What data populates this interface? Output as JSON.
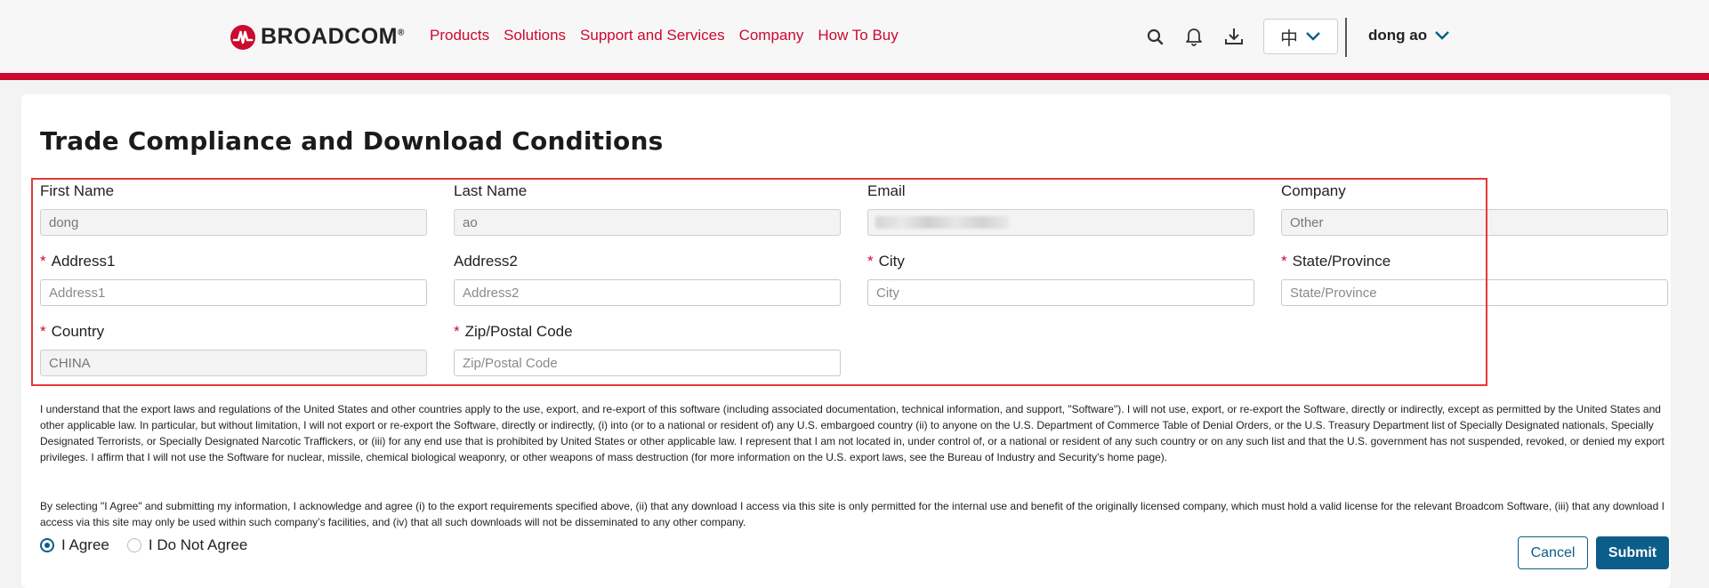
{
  "header": {
    "logo_text": "BROADCOM",
    "logo_mark": "®",
    "nav": [
      "Products",
      "Solutions",
      "Support and Services",
      "Company",
      "How To Buy"
    ],
    "icons": [
      "search-icon",
      "bell-icon",
      "download-icon"
    ],
    "language_glyph": "中",
    "user_name": "dong ao"
  },
  "page": {
    "title": "Trade Compliance and Download Conditions"
  },
  "form": {
    "first_name": {
      "label": "First Name",
      "value": "dong"
    },
    "last_name": {
      "label": "Last Name",
      "value": "ao"
    },
    "email": {
      "label": "Email",
      "value": ""
    },
    "company": {
      "label": "Company",
      "value": "Other"
    },
    "address1": {
      "label": "Address1",
      "placeholder": "Address1",
      "required_mark": "*"
    },
    "address2": {
      "label": "Address2",
      "placeholder": "Address2"
    },
    "city": {
      "label": "City",
      "placeholder": "City",
      "required_mark": "*"
    },
    "state": {
      "label": "State/Province",
      "placeholder": "State/Province",
      "required_mark": "*"
    },
    "country": {
      "label": "Country",
      "value": "CHINA",
      "required_mark": "*"
    },
    "zip": {
      "label": "Zip/Postal Code",
      "placeholder": "Zip/Postal Code",
      "required_mark": "*"
    }
  },
  "legal": {
    "paragraph1": "I understand that the export laws and regulations of the United States and other countries apply to the use, export, and re-export of this software (including associated documentation, technical information, and support, \"Software\"). I will not use, export, or re-export the Software, directly or indirectly, except as permitted by the United States and other applicable law. In particular, but without limitation, I will not export or re-export the Software, directly or indirectly, (i) into (or to a national or resident of) any U.S. embargoed country (ii) to anyone on the U.S. Department of Commerce Table of Denial Orders, or the U.S. Treasury Department list of Specially Designated nationals, Specially Designated Terrorists, or Specially Designated Narcotic Traffickers, or (iii) for any end use that is prohibited by United States or other applicable law. I represent that I am not located in, under control of, or a national or resident of any such country or on any such list and that the U.S. government has not suspended, revoked, or denied my export privileges. I affirm that I will not use the Software for nuclear, missile, chemical biological weaponry, or other weapons of mass destruction (for more information on the U.S. export laws, see the Bureau of Industry and Security's home page).",
    "paragraph2": "By selecting \"I Agree\" and submitting my information, I acknowledge and agree (i) to the export requirements specified above, (ii) that any download I access via this site is only permitted for the internal use and benefit of the originally licensed company, which must hold a valid license for the relevant Broadcom Software, (iii) that any download I access via this site may only be used within such company’s facilities, and (iv) that all such downloads will not be disseminated to any other company."
  },
  "agreement": {
    "agree_label": "I Agree",
    "disagree_label": "I Do Not Agree",
    "selected": "agree"
  },
  "actions": {
    "cancel_label": "Cancel",
    "submit_label": "Submit"
  },
  "colors": {
    "brand_red": "#cc092f",
    "primary_blue": "#0b5d8a",
    "highlight_red": "#e53935"
  }
}
